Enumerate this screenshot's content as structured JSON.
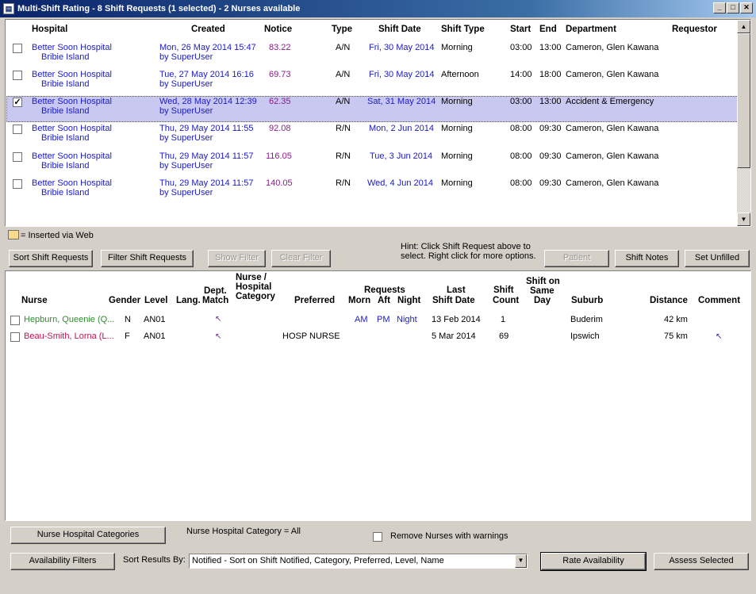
{
  "window": {
    "title": "Multi-Shift Rating - 8 Shift Requests (1 selected) - 2 Nurses available"
  },
  "requests": {
    "headers": {
      "hospital": "Hospital",
      "created": "Created",
      "notice": "Notice",
      "type": "Type",
      "shift_date": "Shift Date",
      "shift_type": "Shift Type",
      "start": "Start",
      "end": "End",
      "department": "Department",
      "requestor": "Requestor"
    },
    "rows": [
      {
        "checked": false,
        "selected": false,
        "hospital": "Better Soon Hospital",
        "hospital2": "Bribie Island",
        "created": "Mon, 26 May 2014 15:47",
        "by": "by SuperUser",
        "notice": "83.22",
        "type": "A/N",
        "shift_date": "Fri, 30 May 2014",
        "shift_type": "Morning",
        "start": "03:00",
        "end": "13:00",
        "department": "Cameron, Glen   Kawana"
      },
      {
        "checked": false,
        "selected": false,
        "hospital": "Better Soon Hospital",
        "hospital2": "Bribie Island",
        "created": "Tue, 27 May 2014 16:16",
        "by": "by SuperUser",
        "notice": "69.73",
        "type": "A/N",
        "shift_date": "Fri, 30 May 2014",
        "shift_type": "Afternoon",
        "start": "14:00",
        "end": "18:00",
        "department": "Cameron, Glen   Kawana"
      },
      {
        "checked": true,
        "selected": true,
        "hospital": "Better Soon Hospital",
        "hospital2": "Bribie Island",
        "created": "Wed, 28 May 2014 12:39",
        "by": "by SuperUser",
        "notice": "62.35",
        "type": "A/N",
        "shift_date": "Sat, 31 May 2014",
        "shift_type": "Morning",
        "start": "03:00",
        "end": "13:00",
        "department": "Accident & Emergency"
      },
      {
        "checked": false,
        "selected": false,
        "hospital": "Better Soon Hospital",
        "hospital2": "Bribie Island",
        "created": "Thu, 29 May 2014 11:55",
        "by": "by SuperUser",
        "notice": "92.08",
        "type": "R/N",
        "shift_date": "Mon, 2 Jun 2014",
        "shift_type": "Morning",
        "start": "08:00",
        "end": "09:30",
        "department": "Cameron, Glen   Kawana"
      },
      {
        "checked": false,
        "selected": false,
        "hospital": "Better Soon Hospital",
        "hospital2": "Bribie Island",
        "created": "Thu, 29 May 2014 11:57",
        "by": "by SuperUser",
        "notice": "116.05",
        "type": "R/N",
        "shift_date": "Tue, 3 Jun 2014",
        "shift_type": "Morning",
        "start": "08:00",
        "end": "09:30",
        "department": "Cameron, Glen   Kawana"
      },
      {
        "checked": false,
        "selected": false,
        "hospital": "Better Soon Hospital",
        "hospital2": "Bribie Island",
        "created": "Thu, 29 May 2014 11:57",
        "by": "by SuperUser",
        "notice": "140.05",
        "type": "R/N",
        "shift_date": "Wed, 4 Jun 2014",
        "shift_type": "Morning",
        "start": "08:00",
        "end": "09:30",
        "department": "Cameron, Glen   Kawana"
      }
    ]
  },
  "legend": {
    "label": "= Inserted via Web",
    "color": "#fbd98a"
  },
  "hint": {
    "line1": "Hint: Click Shift Request above to",
    "line2": "select. Right click for more options."
  },
  "middle_buttons": {
    "sort": "Sort Shift Requests",
    "filter": "Filter Shift Requests",
    "show_filter": "Show Filter",
    "clear_filter": "Clear Filter",
    "patient": "Patient",
    "shift_notes": "Shift Notes",
    "set_unfilled": "Set Unfilled"
  },
  "nurses": {
    "headers": {
      "nurse": "Nurse",
      "gender": "Gender",
      "level": "Level",
      "lang": "Lang.",
      "dept_match_1": "Dept.",
      "dept_match_2": "Match",
      "nhc_1": "Nurse /",
      "nhc_2": "Hospital",
      "nhc_3": "Category",
      "preferred": "Preferred",
      "requests": "Requests",
      "morn": "Morn",
      "aft": "Aft",
      "night": "Night",
      "last_shift_1": "Last",
      "last_shift_2": "Shift Date",
      "shift_count_1": "Shift",
      "shift_count_2": "Count",
      "same_day_1": "Shift on",
      "same_day_2": "Same",
      "same_day_3": "Day",
      "suburb": "Suburb",
      "distance": "Distance",
      "comment": "Comment"
    },
    "rows": [
      {
        "name": "Hepburn, Queenie  (Q...",
        "gender": "N",
        "level": "AN01",
        "preferred": "",
        "morn": "AM",
        "aft": "PM",
        "night": "Night",
        "last_shift": "13 Feb 2014",
        "count": "1",
        "suburb": "Buderim",
        "distance": "42 km"
      },
      {
        "name": "Beau-Smith, Lorna  (L...",
        "gender": "F",
        "level": "AN01",
        "preferred": "HOSP   NURSE",
        "morn": "",
        "aft": "",
        "night": "",
        "last_shift": "5 Mar 2014",
        "count": "69",
        "suburb": "Ipswich",
        "distance": "75 km"
      }
    ]
  },
  "bottom": {
    "nhc_button": "Nurse Hospital Categories",
    "nhc_label": "Nurse Hospital Category = All",
    "remove_warnings": "Remove Nurses with warnings",
    "avail_filters": "Availability Filters",
    "sort_by_label": "Sort Results By:",
    "sort_by_value": "Notified - Sort on Shift Notified, Category, Preferred, Level, Name",
    "rate": "Rate Availability",
    "assess": "Assess Selected"
  }
}
